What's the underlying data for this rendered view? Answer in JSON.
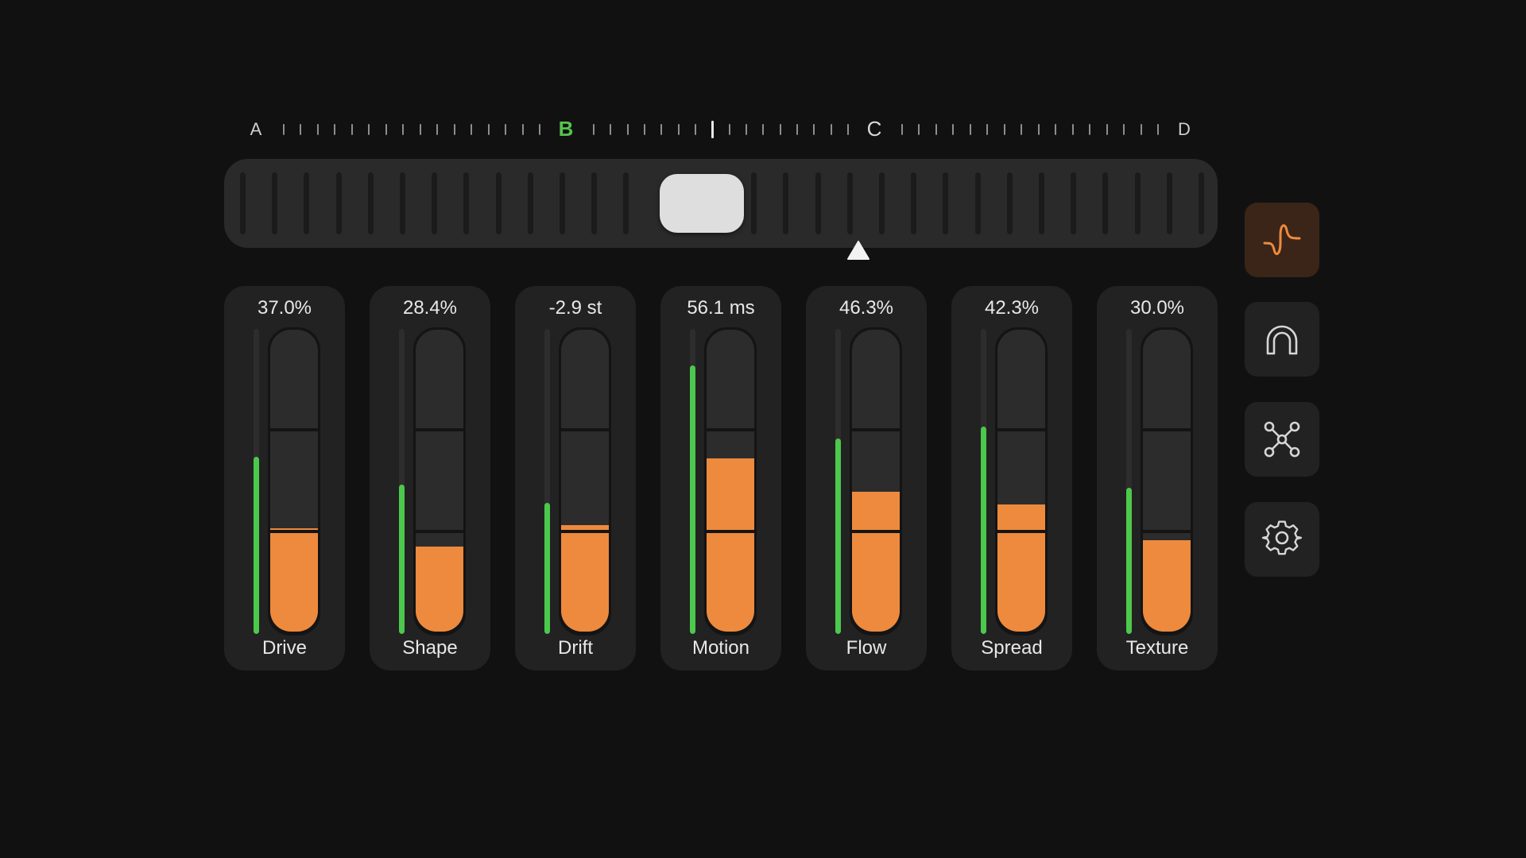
{
  "ruler": {
    "labels": [
      "A",
      "B",
      "C",
      "D"
    ],
    "active_label": "B"
  },
  "scrub": {
    "playhead_position": 0.52
  },
  "channels": [
    {
      "name": "Drive",
      "value": "37.0%",
      "meter_level": 0.58,
      "fill_level": 0.34
    },
    {
      "name": "Shape",
      "value": "28.4%",
      "meter_level": 0.49,
      "fill_level": 0.28
    },
    {
      "name": "Drift",
      "value": "-2.9 st",
      "meter_level": 0.43,
      "fill_level": 0.35
    },
    {
      "name": "Motion",
      "value": "56.1 ms",
      "meter_level": 0.88,
      "fill_level": 0.57
    },
    {
      "name": "Flow",
      "value": "46.3%",
      "meter_level": 0.64,
      "fill_level": 0.46
    },
    {
      "name": "Spread",
      "value": "42.3%",
      "meter_level": 0.68,
      "fill_level": 0.42
    },
    {
      "name": "Texture",
      "value": "30.0%",
      "meter_level": 0.48,
      "fill_level": 0.3
    }
  ],
  "side_buttons": [
    {
      "icon": "waveform-icon",
      "active": true
    },
    {
      "icon": "magnet-icon",
      "active": false
    },
    {
      "icon": "network-icon",
      "active": false
    },
    {
      "icon": "gear-icon",
      "active": false
    }
  ],
  "colors": {
    "accent": "#ee8a3d",
    "meter": "#4cc94c",
    "active_marker": "#54c44c"
  }
}
